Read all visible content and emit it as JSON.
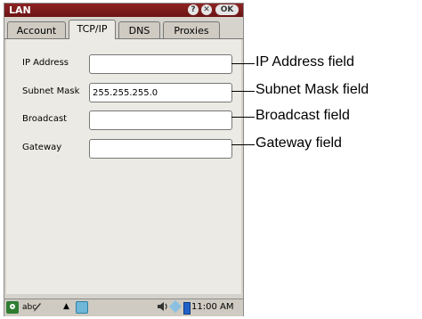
{
  "window": {
    "title": "LAN",
    "help_label": "?",
    "close_label": "✕",
    "ok_label": "OK"
  },
  "tabs": [
    {
      "label": "Account",
      "active": false
    },
    {
      "label": "TCP/IP",
      "active": true
    },
    {
      "label": "DNS",
      "active": false
    },
    {
      "label": "Proxies",
      "active": false
    }
  ],
  "fields": {
    "ip_address": {
      "label": "IP Address",
      "value": ""
    },
    "subnet_mask": {
      "label": "Subnet Mask",
      "value": "255.255.255.0"
    },
    "broadcast": {
      "label": "Broadcast",
      "value": ""
    },
    "gateway": {
      "label": "Gateway",
      "value": ""
    }
  },
  "taskbar": {
    "keyboard_label": "abc",
    "up_label": "▲",
    "clock": "11:00 AM"
  },
  "callouts": {
    "ip_address": "IP Address field",
    "subnet_mask": "Subnet Mask field",
    "broadcast": "Broadcast field",
    "gateway": "Gateway field"
  },
  "icons": {
    "app": "app-menu-icon",
    "pen": "pen-icon",
    "network": "network-status-icon",
    "speaker": "speaker-icon",
    "battery": "battery-icon"
  },
  "colors": {
    "titlebar": "#7a1b1b",
    "panel": "#eceae4",
    "frame": "#d6d3cc"
  }
}
